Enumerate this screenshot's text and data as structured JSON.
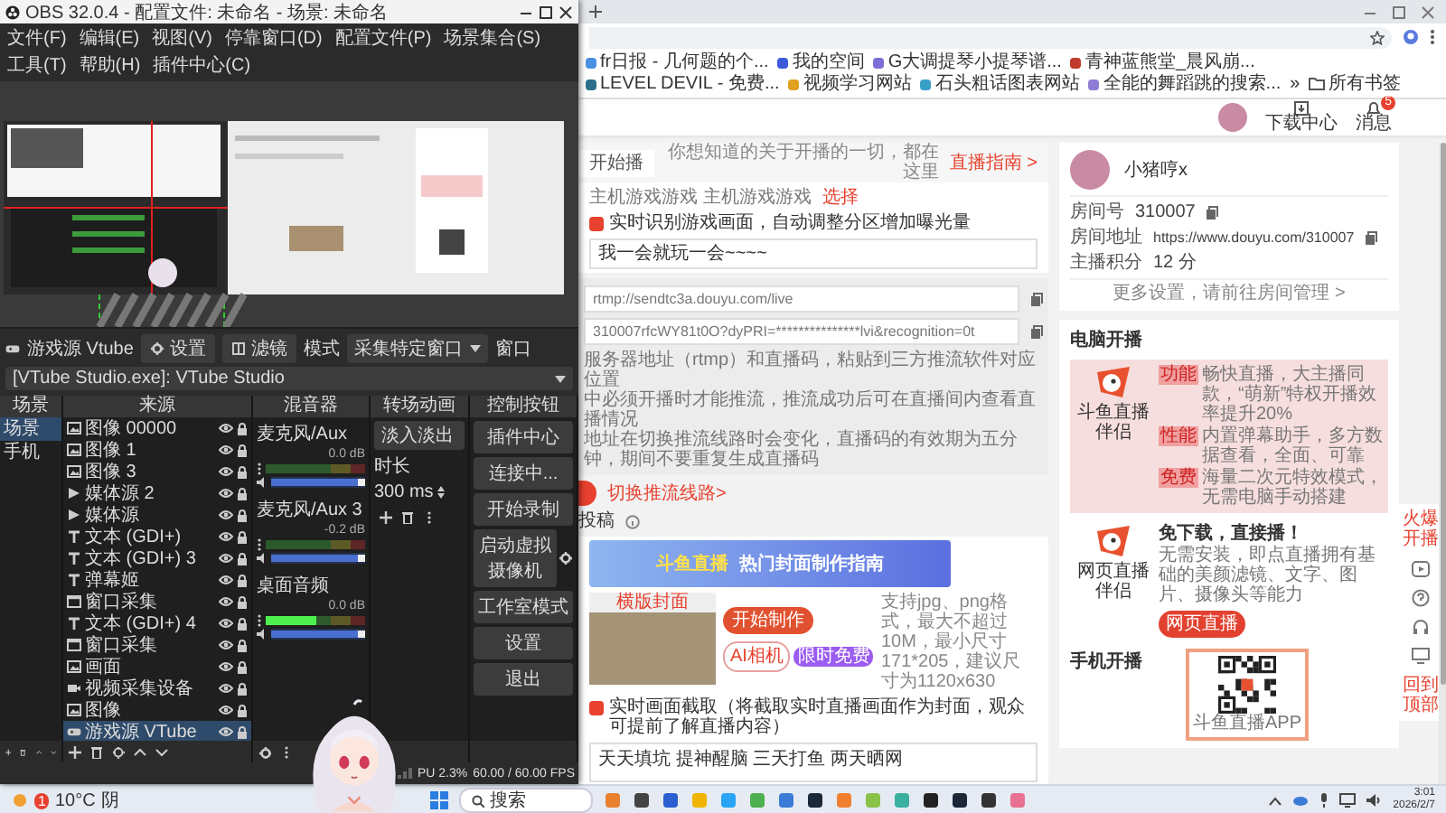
{
  "obs": {
    "title": "OBS 32.0.4 - 配置文件: 未命名 - 场景: 未命名",
    "menu": [
      "文件(F)",
      "编辑(E)",
      "视图(V)",
      "停靠窗口(D)",
      "配置文件(P)",
      "场景集合(S)",
      "工具(T)",
      "帮助(H)",
      "插件中心(C)"
    ],
    "source_bar": {
      "name": "游戏源 Vtube",
      "properties": "设置",
      "filters": "滤镜",
      "mode_label": "模式",
      "mode_value": "采集特定窗口",
      "window_label": "窗口",
      "window_value": "[VTube Studio.exe]: VTube Studio"
    },
    "scenes": {
      "title": "场景",
      "items": [
        {
          "label": "场景",
          "selected": true
        },
        {
          "label": "手机",
          "selected": false
        }
      ]
    },
    "sources": {
      "title": "来源",
      "items": [
        {
          "label": "图像 00000",
          "kind": "image",
          "selected": false
        },
        {
          "label": "图像 1",
          "kind": "image",
          "selected": false
        },
        {
          "label": "图像 3",
          "kind": "image",
          "selected": false
        },
        {
          "label": "媒体源 2",
          "kind": "media",
          "selected": false
        },
        {
          "label": "媒体源",
          "kind": "media",
          "selected": false
        },
        {
          "label": "文本 (GDI+)",
          "kind": "text",
          "selected": false
        },
        {
          "label": "文本 (GDI+) 3",
          "kind": "text",
          "selected": false
        },
        {
          "label": "弹幕姬",
          "kind": "text",
          "selected": false
        },
        {
          "label": "窗口采集",
          "kind": "window",
          "selected": false
        },
        {
          "label": "文本 (GDI+) 4",
          "kind": "text",
          "selected": false
        },
        {
          "label": "窗口采集",
          "kind": "window",
          "selected": false
        },
        {
          "label": "画面",
          "kind": "image",
          "selected": false
        },
        {
          "label": "视频采集设备",
          "kind": "camera",
          "selected": false
        },
        {
          "label": "图像",
          "kind": "image",
          "selected": false
        },
        {
          "label": "游戏源 VTube",
          "kind": "game",
          "selected": true
        }
      ]
    },
    "mixer": {
      "title": "混音器",
      "channels": [
        {
          "name": "麦克风/Aux",
          "reading": "0.0 dB",
          "volume": {
            "level": 0.96
          }
        },
        {
          "name": "麦克风/Aux 3",
          "reading": "-0.2 dB",
          "volume": {
            "level": 0.96
          }
        },
        {
          "name": "桌面音频",
          "reading": "0.0 dB",
          "meter": {
            "level": 0.5
          },
          "volume": {
            "level": 0.96
          }
        }
      ]
    },
    "transitions": {
      "title": "转场动画",
      "value": "淡入淡出",
      "duration_label": "时长",
      "duration": "300 ms"
    },
    "controls": {
      "title": "控制按钮",
      "buttons": [
        {
          "label": "插件中心",
          "gear": false
        },
        {
          "label": "连接中...",
          "gear": false
        },
        {
          "label": "开始录制",
          "gear": false
        },
        {
          "label": "启动虚拟摄像机",
          "gear": true
        },
        {
          "label": "工作室模式",
          "gear": false
        },
        {
          "label": "设置",
          "gear": false
        },
        {
          "label": "退出",
          "gear": false
        }
      ]
    },
    "status": {
      "cpu": "PU 2.3%",
      "fps": "60.00 / 60.00 FPS"
    }
  },
  "browser": {
    "bookmarks": [
      {
        "label": "fr日报 - 几何题的个...",
        "color": "#4a90e2"
      },
      {
        "label": "我的空间",
        "color": "#3b5bdb"
      },
      {
        "label": "G大调提琴小提琴谱...",
        "color": "#7c6fd6"
      },
      {
        "label": "青神蓝熊堂_晨风崩...",
        "color": "#c0392b"
      },
      {
        "label": "LEVEL DEVIL - 免费...",
        "color": "#2c6e8a"
      },
      {
        "label": "视频学习网站",
        "color": "#e0a020"
      },
      {
        "label": "石头粗话图表网站",
        "color": "#3aa0c8"
      },
      {
        "label": "全能的舞蹈跳的搜索...",
        "color": "#8e7cd6"
      }
    ],
    "overflow": "»",
    "all_bookmarks": "所有书签"
  },
  "douyu": {
    "header": {
      "download": "下载中心",
      "messages": "消息",
      "badge": "5"
    },
    "main": {
      "tab": "开始播",
      "hint": "你想知道的关于开播的一切，都在这里",
      "guide": "直播指南 >",
      "category": "主机游戏游戏 主机游戏游戏",
      "choose": "选择",
      "auto_detect": {
        "label": "实时识别游戏画面，自动调整分区增加曝光量",
        "checked": true
      },
      "title_value": "我一会就玩一会~~~~",
      "server": "rtmp://sendtc3a.douyu.com/live",
      "key": "310007rfcWY81t0O?dyPRI=***************lvi&recognition=0t",
      "notes": [
        "服务器地址（rtmp）和直播码，粘贴到三方推流软件对应位置",
        "中必须开播时才能推流，推流成功后可在直播间内查看直播情况",
        "地址在切换推流线路时会变化，直播码的有效期为五分钟，期间不要重复生成直播码"
      ],
      "switch_line": "切换推流线路>",
      "archive": "投稿",
      "banner": {
        "title": "斗鱼直播",
        "subtitle": "热门封面制作指南"
      },
      "cover": {
        "label": "横版封面",
        "make": "开始制作",
        "ai": "AI相机",
        "ai_badge": "限时免费",
        "spec": "支持jpg、png格式，最大不超过10M，最小尺寸171*205，建议尺寸为1120x630"
      },
      "snapshot": {
        "label": "实时画面截取（将截取实时直播画面作为封面，观众可提前了解直播内容）",
        "checked": true
      },
      "description": "天天填坑 提神醒脑 三天打鱼 两天晒网"
    },
    "profile": {
      "name": "小猪哼x",
      "rows": [
        {
          "label": "房间号",
          "value": "310007",
          "copy": true
        },
        {
          "label": "房间地址",
          "value": "https://www.douyu.com/310007",
          "copy": true
        },
        {
          "label": "主播积分",
          "value": "12 分",
          "copy": false
        }
      ],
      "more": "更多设置，请前往房间管理 >"
    },
    "pc": {
      "title": "电脑开播",
      "apps": [
        {
          "kind": "client",
          "name": "斗鱼直播伴侣",
          "features": [
            {
              "tag": "功能",
              "text": "畅快直播，大主播同款，“萌新”特权开播效率提升20%"
            },
            {
              "tag": "性能",
              "text": "内置弹幕助手，多方数据查看，全面、可靠"
            },
            {
              "tag": "免费",
              "text": "海量二次元特效模式，无需电脑手动搭建"
            }
          ]
        },
        {
          "kind": "web",
          "name": "网页直播伴侣",
          "headline": "免下载，直接播！",
          "text": "无需安装，即点直播拥有基础的美颜滤镜、文字、图片、摄像头等能力",
          "button": "网页直播"
        }
      ]
    },
    "mobile": {
      "title": "手机开播",
      "qr_caption": "斗鱼直播APP"
    },
    "side": {
      "top": "火爆开播",
      "bottom": "回到顶部"
    }
  },
  "taskbar": {
    "weather": "10°C",
    "condition": "阴",
    "badge": "1",
    "search": "搜索",
    "time": "3:01",
    "date": "2026/2/7"
  }
}
